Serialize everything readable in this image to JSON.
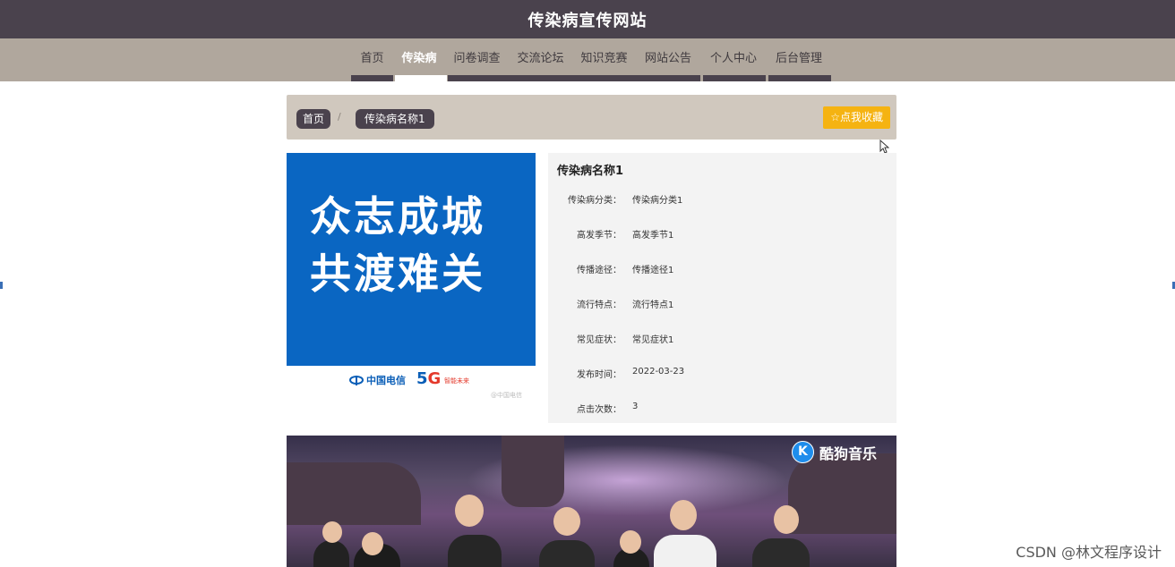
{
  "site": {
    "title": "传染病宣传网站"
  },
  "nav": {
    "items": [
      {
        "label": "首页"
      },
      {
        "label": "传染病",
        "active": true
      },
      {
        "label": "问卷调查"
      },
      {
        "label": "交流论坛"
      },
      {
        "label": "知识竞赛"
      },
      {
        "label": "网站公告"
      },
      {
        "label": "个人中心"
      },
      {
        "label": "后台管理"
      }
    ]
  },
  "breadcrumb": {
    "home": "首页",
    "separator": "/",
    "current": "传染病名称1",
    "favorite_button": "☆点我收藏"
  },
  "poster": {
    "line1": "众志成城",
    "line2": "共渡难关",
    "logo_text": "中国电信",
    "fiveg_tag": "智能未来",
    "weibo_mark": "@中国电信",
    "colors": {
      "background": "#0a66c2",
      "text": "#ffffff"
    }
  },
  "detail": {
    "title": "传染病名称1",
    "fields": [
      {
        "label": "传染病分类：",
        "value": "传染病分类1"
      },
      {
        "label": "高发季节：",
        "value": "高发季节1"
      },
      {
        "label": "传播途径：",
        "value": "传播途径1"
      },
      {
        "label": "流行特点：",
        "value": "流行特点1"
      },
      {
        "label": "常见症状：",
        "value": "常见症状1"
      },
      {
        "label": "发布时间：",
        "value": "2022-03-23"
      },
      {
        "label": "点击次数：",
        "value": "3"
      }
    ]
  },
  "video": {
    "brand": "酷狗音乐",
    "brand_icon": "K"
  },
  "watermark": "CSDN @林文程序设计",
  "colors": {
    "header": "#4a424d",
    "nav": "#b0a79d",
    "breadcrumb_bar": "#d0c8be",
    "favorite": "#f5b312",
    "panel": "#f3f3f3"
  }
}
